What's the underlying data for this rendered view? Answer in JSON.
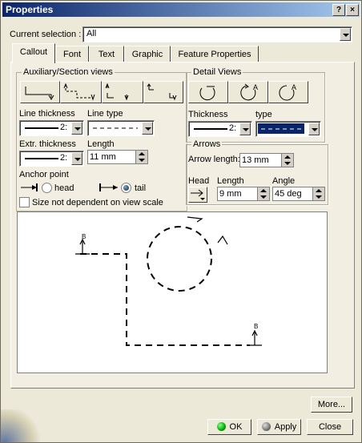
{
  "window": {
    "title": "Properties",
    "help_btn": "?",
    "close_btn": "×"
  },
  "current_selection": {
    "label": "Current selection :",
    "value": "All"
  },
  "tabs": [
    {
      "label": "Callout"
    },
    {
      "label": "Font"
    },
    {
      "label": "Text"
    },
    {
      "label": "Graphic"
    },
    {
      "label": "Feature Properties"
    }
  ],
  "aux": {
    "title": "Auxiliary/Section views",
    "line_thickness_label": "Line thickness",
    "line_thickness_value": "2:",
    "line_type_label": "Line type",
    "extr_thickness_label": "Extr. thickness",
    "extr_thickness_value": "2:",
    "length_label": "Length",
    "length_value": "11 mm",
    "anchor_label": "Anchor point",
    "head_label": "head",
    "tail_label": "tail",
    "size_checkbox_label": "Size not dependent on view scale"
  },
  "detail": {
    "title": "Detail Views",
    "thickness_label": "Thickness",
    "thickness_value": "2:",
    "type_label": "type"
  },
  "arrows": {
    "title": "Arrows",
    "arrow_length_label": "Arrow length:",
    "arrow_length_value": "13 mm",
    "head_label": "Head",
    "length_label": "Length",
    "length_value": "9 mm",
    "angle_label": "Angle",
    "angle_value": "45 deg"
  },
  "preview": {
    "label_left": "B",
    "label_right": "B"
  },
  "buttons": {
    "more": "More...",
    "ok": "OK",
    "apply": "Apply",
    "close": "Close"
  }
}
